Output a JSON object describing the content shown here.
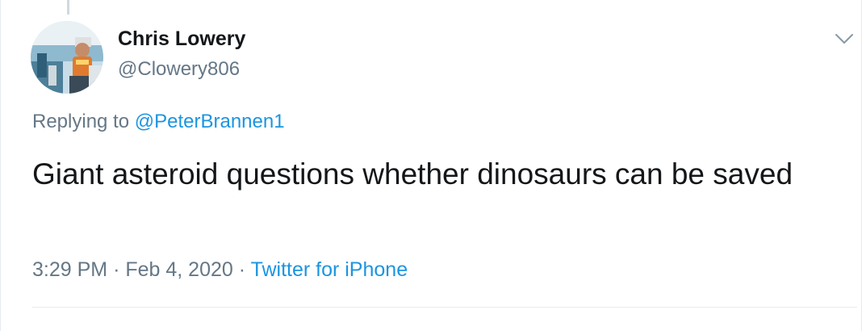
{
  "tweet": {
    "author": {
      "display_name": "Chris Lowery",
      "handle": "@Clowery806"
    },
    "replying_prefix": "Replying to",
    "replying_to": "@PeterBrannen1",
    "text": "Giant asteroid questions whether dinosaurs can be saved",
    "time": "3:29 PM",
    "separator_1": "·",
    "date": "Feb 4, 2020",
    "separator_2": "·",
    "source": "Twitter for iPhone"
  },
  "icons": {
    "menu": "chevron-down-icon"
  },
  "colors": {
    "text_primary": "#14171a",
    "text_secondary": "#657786",
    "link": "#1b95e0",
    "divider": "#e6ecf0"
  }
}
